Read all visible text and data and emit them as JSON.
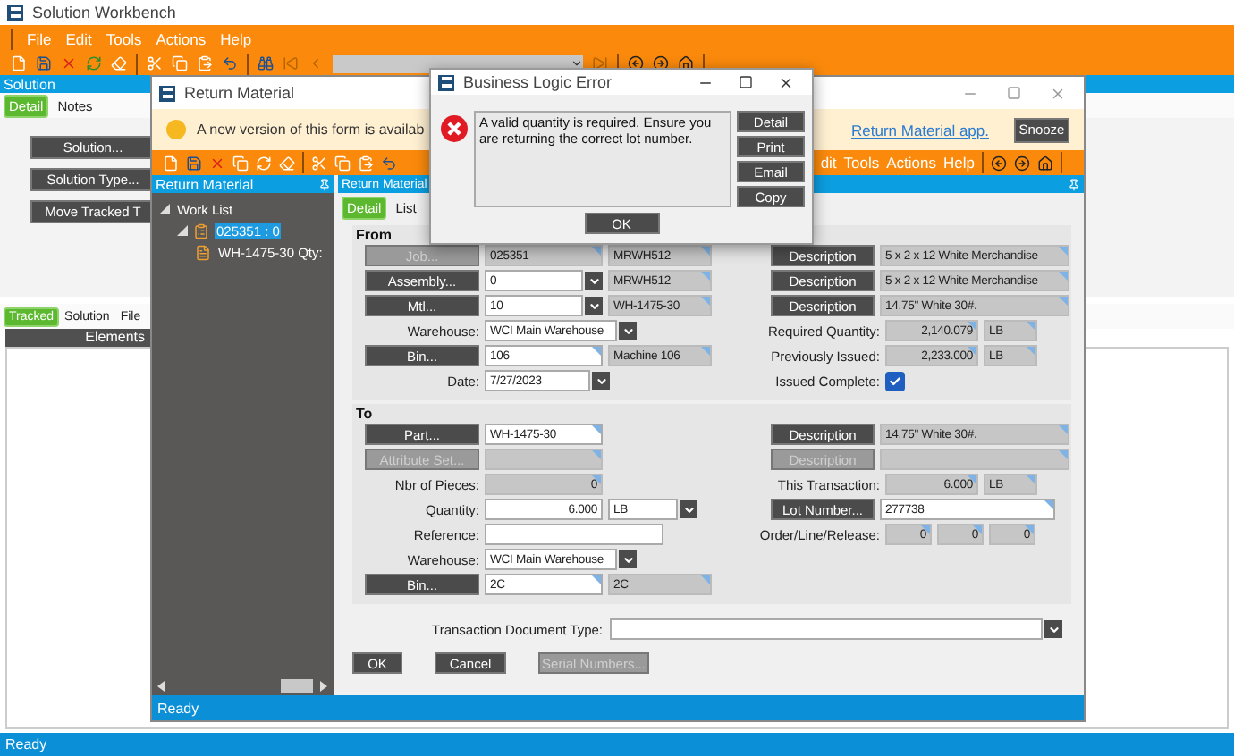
{
  "main_window": {
    "title": "Solution Workbench",
    "menu": [
      "File",
      "Edit",
      "Tools",
      "Actions",
      "Help"
    ],
    "panel_title": "Solution",
    "tabs": [
      {
        "label": "Detail",
        "selected": true
      },
      {
        "label": "Notes",
        "selected": false
      }
    ],
    "buttons": [
      "Solution...",
      "Solution Type...",
      "Move Tracked T"
    ],
    "lower_tabs": [
      {
        "label": "Tracked",
        "selected": true
      },
      {
        "label": "Solution",
        "selected": false
      },
      {
        "label": "File",
        "selected": false
      }
    ],
    "grid_column": "Elements",
    "status_bar": "Ready"
  },
  "return_material": {
    "title": "Return Material",
    "notice": {
      "text": "A new version of this form is availab",
      "link": "Return Material app.",
      "button": "Snooze"
    },
    "menu": [
      "dit",
      "Tools",
      "Actions",
      "Help"
    ],
    "tree_panel_title": "Return Material",
    "tree": [
      {
        "label": "Work List",
        "expanded": true,
        "selected": false,
        "children": [
          {
            "label": "025351 : 0",
            "expanded": true,
            "selected": true,
            "children": [
              {
                "label": "WH-1475-30 Qty:",
                "selected": false
              }
            ]
          }
        ]
      }
    ],
    "form_panel_title": "Return Material",
    "tabs": [
      {
        "label": "Detail",
        "selected": true
      },
      {
        "label": "List",
        "selected": false
      }
    ],
    "groups": [
      {
        "title": "From",
        "left": [
          {
            "kind": "button",
            "label": "Job...",
            "disabled": true,
            "fields": [
              {
                "kind": "readonly",
                "value": "025351"
              },
              {
                "kind": "readonly",
                "value": "MRWH512"
              }
            ]
          },
          {
            "kind": "button",
            "label": "Assembly...",
            "disabled": false,
            "fields": [
              {
                "kind": "select",
                "value": "0"
              },
              {
                "kind": "readonly",
                "value": "MRWH512"
              }
            ]
          },
          {
            "kind": "button",
            "label": "Mtl...",
            "disabled": false,
            "fields": [
              {
                "kind": "select",
                "value": "10"
              },
              {
                "kind": "readonly",
                "value": "WH-1475-30"
              }
            ]
          },
          {
            "kind": "label",
            "label": "Warehouse:",
            "fields": [
              {
                "kind": "select",
                "value": "WCI Main Warehouse"
              }
            ]
          },
          {
            "kind": "button",
            "label": "Bin...",
            "disabled": false,
            "fields": [
              {
                "kind": "lookup",
                "value": "106"
              },
              {
                "kind": "readonly",
                "value": "Machine 106"
              }
            ]
          },
          {
            "kind": "label",
            "label": "Date:",
            "fields": [
              {
                "kind": "date",
                "value": "7/27/2023"
              }
            ]
          }
        ],
        "right": [
          {
            "kind": "button",
            "label": "Description",
            "disabled": false,
            "fields": [
              {
                "kind": "readonly",
                "value": "5 x 2 x 12 White Merchandise"
              }
            ]
          },
          {
            "kind": "button",
            "label": "Description",
            "disabled": false,
            "fields": [
              {
                "kind": "readonly",
                "value": "5 x 2 x 12 White Merchandise"
              }
            ]
          },
          {
            "kind": "button",
            "label": "Description",
            "disabled": false,
            "fields": [
              {
                "kind": "readonly",
                "value": "14.75\" White 30#."
              }
            ]
          },
          {
            "kind": "label",
            "label": "Required Quantity:",
            "fields": [
              {
                "kind": "readonly-number",
                "value": "2,140.079"
              },
              {
                "kind": "readonly",
                "value": "LB"
              }
            ]
          },
          {
            "kind": "label",
            "label": "Previously Issued:",
            "fields": [
              {
                "kind": "readonly-number",
                "value": "2,233.000"
              },
              {
                "kind": "readonly",
                "value": "LB"
              }
            ]
          },
          {
            "kind": "label",
            "label": "Issued Complete:",
            "fields": [
              {
                "kind": "checkbox",
                "checked": true
              }
            ]
          }
        ]
      },
      {
        "title": "To",
        "left": [
          {
            "kind": "button",
            "label": "Part...",
            "disabled": false,
            "fields": [
              {
                "kind": "lookup",
                "value": "WH-1475-30"
              }
            ]
          },
          {
            "kind": "button",
            "label": "Attribute Set...",
            "disabled": true,
            "fields": [
              {
                "kind": "readonly"
              }
            ]
          },
          {
            "kind": "label",
            "label": "Nbr of Pieces:",
            "fields": [
              {
                "kind": "readonly-number",
                "value": "0"
              }
            ]
          },
          {
            "kind": "label",
            "label": "Quantity:",
            "fields": [
              {
                "kind": "number",
                "value": "6.000"
              },
              {
                "kind": "select",
                "value": "LB"
              }
            ]
          },
          {
            "kind": "label",
            "label": "Reference:",
            "fields": [
              {
                "kind": "text"
              }
            ]
          },
          {
            "kind": "label",
            "label": "Warehouse:",
            "fields": [
              {
                "kind": "select",
                "value": "WCI Main Warehouse"
              }
            ]
          },
          {
            "kind": "button",
            "label": "Bin...",
            "disabled": false,
            "fields": [
              {
                "kind": "lookup",
                "value": "2C"
              },
              {
                "kind": "readonly",
                "value": "2C"
              }
            ]
          }
        ],
        "right": [
          {
            "kind": "button",
            "label": "Description",
            "disabled": false,
            "fields": [
              {
                "kind": "readonly",
                "value": "14.75\" White 30#."
              }
            ]
          },
          {
            "kind": "button",
            "label": "Description",
            "disabled": true,
            "fields": [
              {
                "kind": "readonly"
              }
            ]
          },
          {
            "kind": "label",
            "label": "This Transaction:",
            "fields": [
              {
                "kind": "readonly-number",
                "value": "6.000"
              },
              {
                "kind": "readonly",
                "value": "LB"
              }
            ]
          },
          {
            "kind": "button",
            "label": "Lot Number...",
            "disabled": false,
            "fields": [
              {
                "kind": "lookup",
                "value": "277738"
              }
            ]
          },
          {
            "kind": "label",
            "label": "Order/Line/Release:",
            "fields": [
              {
                "kind": "readonly-number",
                "value": "0"
              },
              {
                "kind": "readonly-number",
                "value": "0"
              },
              {
                "kind": "readonly-number",
                "value": "0"
              }
            ]
          }
        ]
      }
    ],
    "transaction_document_type": {
      "label": "Transaction Document Type:"
    },
    "buttons": [
      {
        "label": "OK",
        "disabled": false
      },
      {
        "label": "Cancel",
        "disabled": false
      },
      {
        "label": "Serial Numbers...",
        "disabled": true
      }
    ],
    "status_bar": "Ready"
  },
  "dialog": {
    "title": "Business Logic Error",
    "message": "A valid quantity is required. Ensure you are returning the correct lot number.",
    "side_buttons": [
      "Detail",
      "Print",
      "Email",
      "Copy"
    ],
    "ok": "OK"
  }
}
